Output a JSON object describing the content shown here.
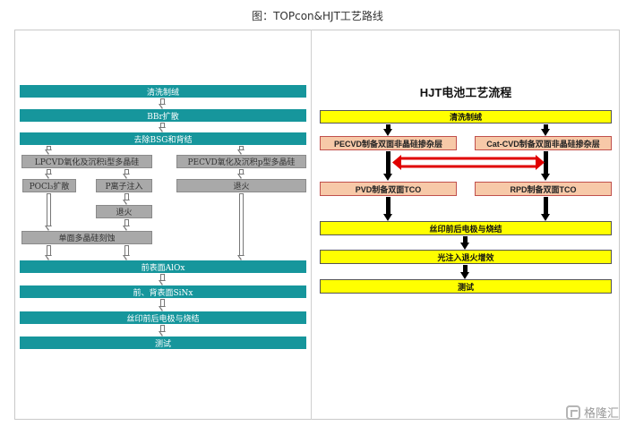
{
  "caption": "图：TOPcon&HJT工艺路线",
  "topcon": {
    "bar_clean": "清洗制绒",
    "bar_bbr": "BBr扩散",
    "bar_bsg": "去除BSG和背结",
    "box_lpcvd": "LPCVD氧化及沉积i型多晶硅",
    "box_pecvd": "PECVD氧化及沉积p型多晶硅",
    "box_pocl": "POCl₃扩散",
    "box_p_ion": "P离子注入",
    "box_anneal_left": "退火",
    "box_anneal_right": "退火",
    "box_single_etch": "单面多晶硅刻蚀",
    "bar_front_alox": "前表面AlOx",
    "bar_sinx": "前、背表面SiNx",
    "bar_print": "丝印前后电极与烧结",
    "bar_test": "测试"
  },
  "hjt": {
    "title": "HJT电池工艺流程",
    "bar_clean": "清洗制绒",
    "box_pecvd": "PECVD制备双面非晶硅掺杂层",
    "box_catcvd": "Cat-CVD制备双面非晶硅掺杂层",
    "box_pvd": "PVD制备双面TCO",
    "box_rpd": "RPD制备双面TCO",
    "bar_print": "丝印前后电极与烧结",
    "bar_light": "光注入退火增效",
    "bar_test": "测试",
    "double_arrow_color": "#e00000"
  },
  "watermark": "格隆汇"
}
